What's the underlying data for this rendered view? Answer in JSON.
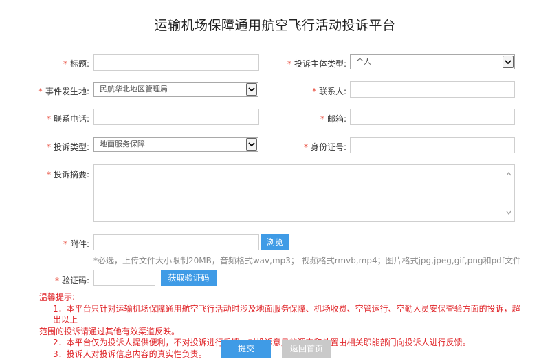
{
  "page": {
    "title": "运输机场保障通用航空飞行活动投诉平台"
  },
  "form": {
    "title_label": "标题:",
    "complainant_type_label": "投诉主体类型:",
    "complainant_type_value": "个人",
    "incident_location_label": "事件发生地:",
    "incident_location_value": "民航华北地区管理局",
    "contact_person_label": "联系人:",
    "phone_label": "联系电话:",
    "email_label": "邮箱:",
    "complaint_type_label": "投诉类型:",
    "complaint_type_value": "地面服务保障",
    "id_number_label": "身份证号:",
    "summary_label": "投诉摘要:",
    "attachment_label": "附件:",
    "browse_button": "浏览",
    "attachment_note": "*必选，上传文件大小限制20MB，音频格式wav,mp3；  视频格式rmvb,mp4；图片格式jpg,jpeg,gif,png和pdf文件",
    "captcha_label": "验证码:",
    "get_captcha_button": "获取验证码",
    "required_mark": "*"
  },
  "tips": {
    "heading": "温馨提示:",
    "item1_line1": "1．本平台只针对运输机场保障通用航空飞行活动时涉及地面服务保障、机场收费、空管运行、空勤人员安保查验方面的投诉，超出以上",
    "item1_line2": "范围的投诉请通过其他有效渠道反映。",
    "item2": "2．本平台仅为投诉人提供便利，不对投诉进行反馈，对投诉意见的调查和处置由相关职能部门向投诉人进行反馈。",
    "item3": "3．投诉人对投诉信息内容的真实性负责。"
  },
  "actions": {
    "submit": "提交",
    "back_home": "返回首页"
  },
  "colors": {
    "accent": "#3f9be6",
    "required": "#e84a3a",
    "tips": "#e0262a",
    "disabled": "#c9c9c9"
  }
}
